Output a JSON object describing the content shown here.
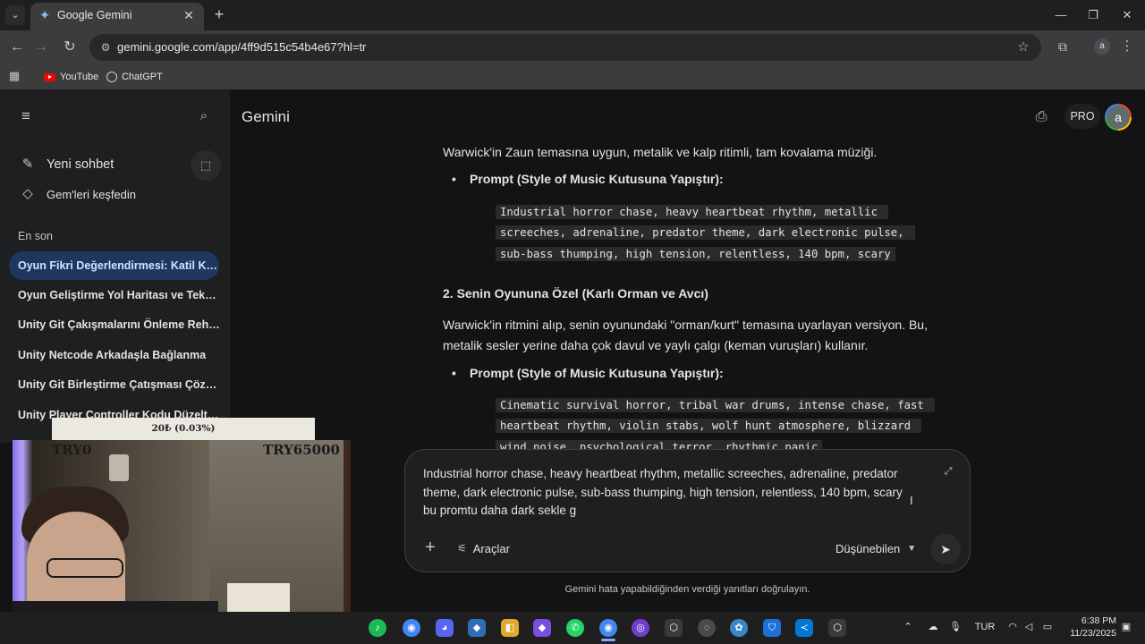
{
  "browser": {
    "tab_title": "Google Gemini",
    "url": "gemini.google.com/app/4ff9d515c54b4e67?hl=tr",
    "profile_initial": "a",
    "bookmarks": [
      {
        "label": "YouTube",
        "icon": "youtube-icon"
      },
      {
        "label": "ChatGPT",
        "icon": "chatgpt-icon"
      }
    ]
  },
  "sidebar": {
    "new_chat": "Yeni sohbet",
    "explore_gems": "Gem'leri keşfedin",
    "recent_header": "En son",
    "chats": [
      "Oyun Fikri Değerlendirmesi: Katil Köylü",
      "Oyun Geliştirme Yol Haritası ve Teknik...",
      "Unity Git Çakışmalarını Önleme Rehb...",
      "Unity Netcode Arkadaşla Bağlanma",
      "Unity Git Birleştirme Çatışması Çözümü",
      "Unity Player Controller Kodu Düzeltme"
    ]
  },
  "header": {
    "title": "Gemini",
    "plan_badge": "PRO",
    "avatar_initial": "a"
  },
  "content": {
    "intro": "Warwick'in Zaun temasına uygun, metalik ve kalp ritimli, tam kovalama müziği.",
    "bullet1": "Prompt (Style of Music Kutusuna Yapıştır):",
    "code1": "Industrial horror chase, heavy heartbeat rhythm, metallic screeches, adrenaline, predator theme, dark electronic pulse, sub-bass thumping, high tension, relentless, 140 bpm, scary",
    "heading2": "2. Senin Oyununa Özel (Karlı Orman ve Avcı)",
    "para2": "Warwick'in ritmini alıp, senin oyunundaki \"orman/kurt\" temasına uyarlayan versiyon. Bu, metalik sesler yerine daha çok davul ve yaylı çalgı (keman vuruşları) kullanır.",
    "bullet2": "Prompt (Style of Music Kutusuna Yapıştır):",
    "code2": "Cinematic survival horror, tribal war drums, intense chase, fast heartbeat rhythm, violin stabs, wolf hunt atmosphere, blizzard wind noise, psychological terror, rhythmic panic"
  },
  "prompt": {
    "text_line1": "Industrial horror chase, heavy heartbeat rhythm, metallic screeches, adrenaline, predator theme, dark electronic pulse, sub-bass thumping, high tension, relentless, 140 bpm, scary",
    "text_line2": "bu promtu daha dark sekle g",
    "tools_label": "Araçlar",
    "model_label": "Düşünebilen",
    "disclaimer": "Gemini hata yapabildiğinden verdiği yanıtları doğrulayın."
  },
  "overlay": {
    "goal_amount": "20₺ (0.03%)",
    "goal_progress_percent": 0.03,
    "label_left": "TRY0",
    "label_right": "TRY65000"
  },
  "taskbar": {
    "language": "TUR",
    "time": "6:38 PM",
    "date": "11/23/2025"
  },
  "colors": {
    "background": "#131314",
    "sidebar": "#1e1f20",
    "active_chat": "#1f3760",
    "code_bg": "#282a2c",
    "chrome_toolbar": "#3c3c3c"
  }
}
